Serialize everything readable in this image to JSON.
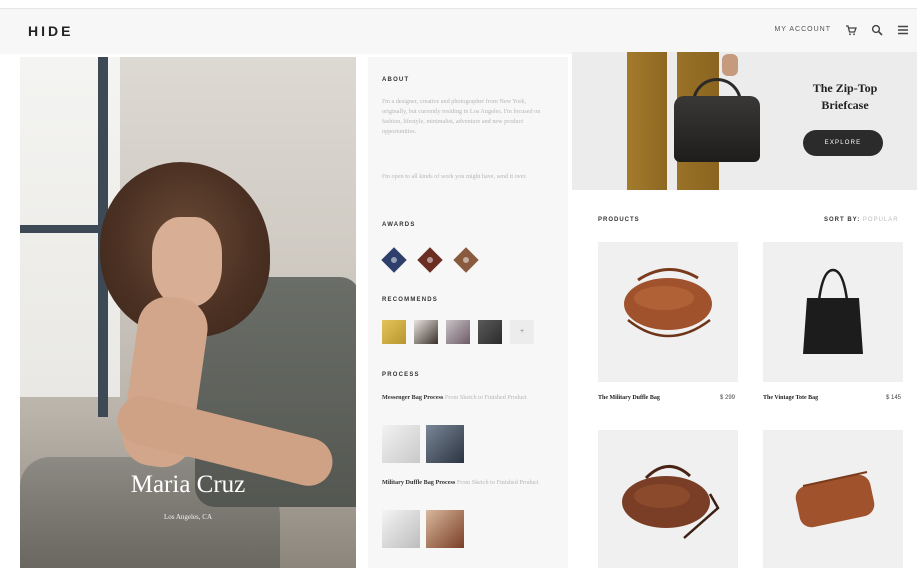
{
  "header": {
    "logo": "HIDE",
    "account_label": "MY ACCOUNT",
    "icons": [
      "cart-icon",
      "search-icon",
      "menu-icon"
    ]
  },
  "hero": {
    "name": "Maria Cruz",
    "location": "Los Angeles, CA"
  },
  "about": {
    "title": "ABOUT",
    "paragraph1": "I'm a designer, creative and photographer from New York, originally, but currently residing in Los Angeles. I'm focused on fashion, lifestyle, minimalist, adventure and new product opportunities.",
    "paragraph2": "I'm open to all kinds of work you might have, send it over."
  },
  "awards": {
    "title": "AWARDS",
    "colors": [
      "#2f3f6b",
      "#6b2e22",
      "#8a5a3e"
    ]
  },
  "recommends": {
    "title": "RECOMMENDS",
    "more_label": "+"
  },
  "process": {
    "title": "PROCESS",
    "items": [
      {
        "name": "Messenger Bag Process",
        "desc": "From Sketch to Finished Product"
      },
      {
        "name": "Military Duffle Bag Process",
        "desc": "From Sketch to Finished Product"
      }
    ]
  },
  "banner": {
    "title": "The Zip-Top Briefcase",
    "button_label": "EXPLORE"
  },
  "products": {
    "title": "PRODUCTS",
    "sort_label": "SORT BY:",
    "sort_value": "POPULAR",
    "items": [
      {
        "name": "The Military Duffle Bag",
        "price": "$ 299"
      },
      {
        "name": "The Vintage Tote Bag",
        "price": "$ 145"
      }
    ]
  },
  "colors": {
    "leather_brown": "#a0522d",
    "tote_black": "#1c1c1c",
    "button_dark": "#2b2b2b"
  }
}
